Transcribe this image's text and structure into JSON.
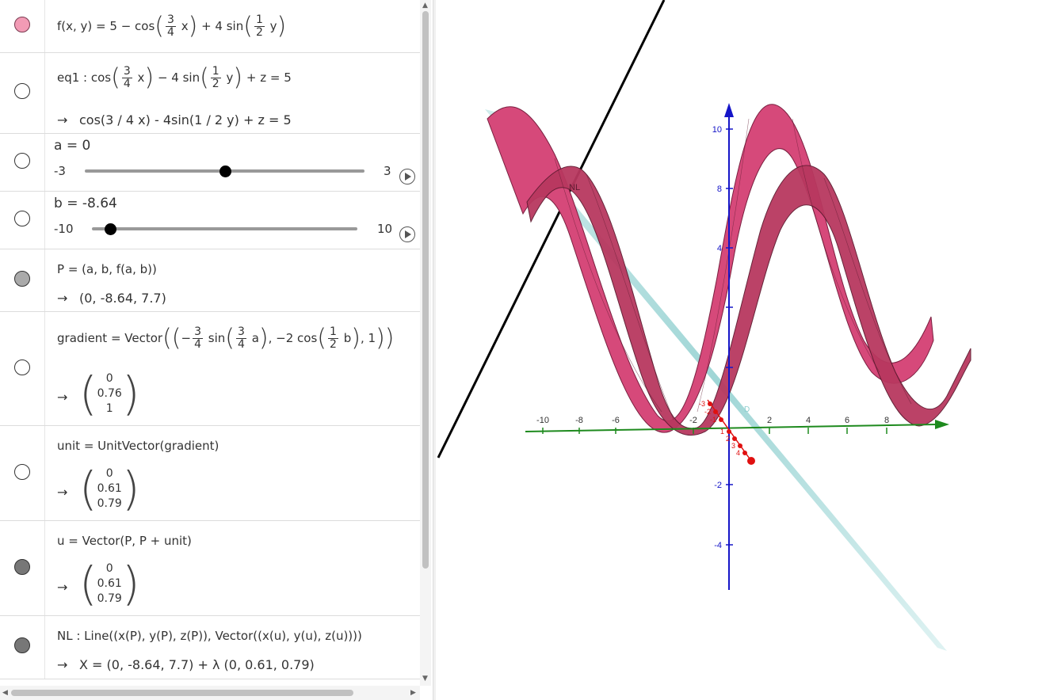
{
  "rows": [
    {
      "id": "f",
      "dot": "#f29bb5",
      "pre": "f(x, y)  =  5 − cos",
      "f1n": "3",
      "f1d": "4",
      "mid": "x",
      "plus": "+ 4  sin",
      "f2n": "1",
      "f2d": "2",
      "post": "y"
    },
    {
      "id": "eq1",
      "dot": "#ffffff",
      "pre": "eq1 : cos",
      "f1n": "3",
      "f1d": "4",
      "mid": "x",
      "minus": "− 4  sin",
      "f2n": "1",
      "f2d": "2",
      "post": "y",
      "tail": "+ z  =  5",
      "out": "cos(3 / 4 x) - 4sin(1 / 2 y) + z = 5"
    },
    {
      "id": "a",
      "dot": "#ffffff",
      "label": "a = 0",
      "min": "-3",
      "max": "3",
      "value": 0,
      "lo": -3,
      "hi": 3
    },
    {
      "id": "b",
      "dot": "#ffffff",
      "label": "b = -8.64",
      "min": "-10",
      "max": "10",
      "value": -8.64,
      "lo": -10,
      "hi": 10
    },
    {
      "id": "P",
      "dot": "#aaaaaa",
      "def": "P  =  (a, b, f(a, b))",
      "out": "(0, -8.64, 7.7)"
    },
    {
      "id": "gradient",
      "dot": "#ffffff",
      "pre": "gradient  =  Vector",
      "s1": "−",
      "f1n": "3",
      "f1d": "4",
      "t1": "sin",
      "f2n": "3",
      "f2d": "4",
      "t2": "a",
      "t3": ", −2  cos",
      "f3n": "1",
      "f3d": "2",
      "t4": "b",
      "t5": ", 1",
      "vec": [
        "0",
        "0.76",
        "1"
      ]
    },
    {
      "id": "unit",
      "dot": "#ffffff",
      "def": "unit  =  UnitVector(gradient)",
      "vec": [
        "0",
        "0.61",
        "0.79"
      ]
    },
    {
      "id": "u",
      "dot": "#777777",
      "def": "u  =  Vector(P, P + unit)",
      "vec": [
        "0",
        "0.61",
        "0.79"
      ]
    },
    {
      "id": "NL",
      "dot": "#777777",
      "def": "NL : Line((x(P), y(P), z(P)), Vector((x(u), y(u), z(u))))",
      "out": "X  =  (0, -8.64, 7.7) + λ (0, 0.61, 0.79)"
    }
  ],
  "arrow": "→",
  "graphics": {
    "x_ticks": [
      "-10",
      "-8",
      "-6",
      "-2",
      "2",
      "4",
      "6",
      "8"
    ],
    "z_ticks": [
      "10",
      "8",
      "4",
      "-2",
      "-4"
    ],
    "y_ticks": [
      "-3",
      "-2",
      "-1",
      "1",
      "2",
      "3",
      "4"
    ],
    "label_D": "D",
    "label_NL": "NL",
    "surface_color": "#d6497a",
    "plane_color": "#9fd6d6",
    "x_axis_color": "#1e8a1e",
    "z_axis_color": "#1515c8",
    "y_axis_color": "#e01010"
  }
}
